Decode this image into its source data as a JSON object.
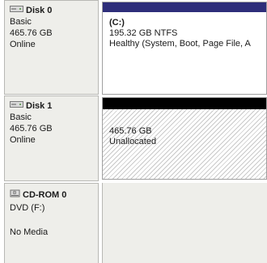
{
  "colors": {
    "primary_partition_bar": "#2e2e7a",
    "unallocated_bar": "#000000",
    "label_bg": "#eeeeea"
  },
  "disks": [
    {
      "name": "Disk 0",
      "type": "Basic",
      "size": "465.76 GB",
      "status": "Online",
      "icon": "hard-disk-icon",
      "partition": {
        "label": "(C:)",
        "size_fs": "195.32 GB NTFS",
        "health": "Healthy (System, Boot, Page File, A"
      }
    },
    {
      "name": "Disk 1",
      "type": "Basic",
      "size": "465.76 GB",
      "status": "Online",
      "icon": "hard-disk-icon",
      "partition": {
        "size": "465.76 GB",
        "state": "Unallocated"
      }
    },
    {
      "name": "CD-ROM 0",
      "type": "DVD (F:)",
      "status": "No Media",
      "icon": "cd-rom-icon"
    }
  ]
}
